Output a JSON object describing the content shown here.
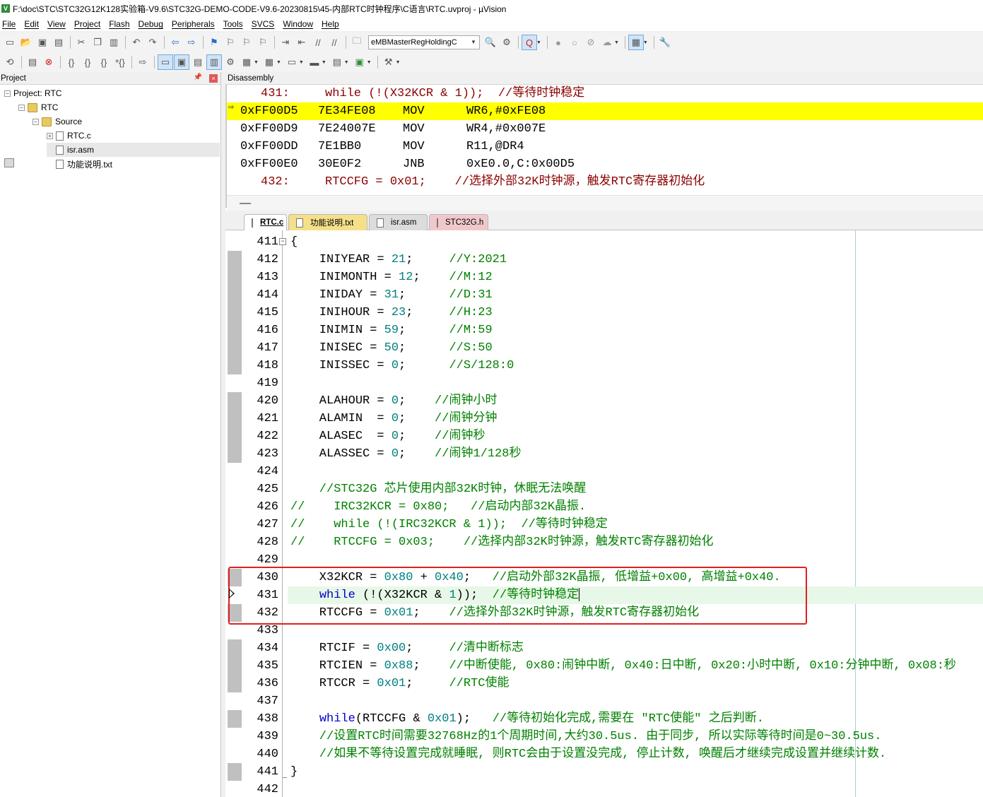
{
  "window": {
    "title": "F:\\doc\\STC\\STC32G12K128实验箱-V9.6\\STC32G-DEMO-CODE-V9.6-20230815\\45-内部RTC时钟程序\\C语言\\RTC.uvproj - µVision"
  },
  "menu": [
    "File",
    "Edit",
    "View",
    "Project",
    "Flash",
    "Debug",
    "Peripherals",
    "Tools",
    "SVCS",
    "Window",
    "Help"
  ],
  "toolbar": {
    "target_combo": "eMBMasterRegHoldingC"
  },
  "project_pane": {
    "title": "Project",
    "tree": [
      {
        "label": "Project: RTC",
        "type": "proj"
      },
      {
        "label": "RTC",
        "type": "folder"
      },
      {
        "label": "Source",
        "type": "folder"
      },
      {
        "label": "RTC.c",
        "type": "file"
      },
      {
        "label": "isr.asm",
        "type": "file"
      },
      {
        "label": "功能说明.txt",
        "type": "file"
      }
    ]
  },
  "disassembly": {
    "title": "Disassembly",
    "rows": [
      {
        "kind": "src",
        "num": "431:",
        "text": "while (!(X32KCR & 1));  //等待时钟稳定"
      },
      {
        "kind": "asm",
        "addr": "0xFF00D5",
        "opcode": "7E34FE08",
        "mnem": "MOV",
        "ops": "WR6,#0xFE08",
        "current": true
      },
      {
        "kind": "asm",
        "addr": "0xFF00D9",
        "opcode": "7E24007E",
        "mnem": "MOV",
        "ops": "WR4,#0x007E"
      },
      {
        "kind": "asm",
        "addr": "0xFF00DD",
        "opcode": "7E1BB0",
        "mnem": "MOV",
        "ops": "R11,@DR4"
      },
      {
        "kind": "asm",
        "addr": "0xFF00E0",
        "opcode": "30E0F2",
        "mnem": "JNB",
        "ops": "0xE0.0,C:0x00D5"
      },
      {
        "kind": "src",
        "num": "432:",
        "text": "RTCCFG = 0x01;    //选择外部32K时钟源，触发RTC寄存器初始化"
      }
    ]
  },
  "tabs": [
    {
      "label": "RTC.c",
      "active": true,
      "color": "#ffffff"
    },
    {
      "label": "功能说明.txt",
      "color": "#f5e08a"
    },
    {
      "label": "isr.asm",
      "color": "#dcdcdc"
    },
    {
      "label": "STC32G.h",
      "color": "#f0c8cc"
    }
  ],
  "editor": {
    "lines": [
      {
        "n": "411",
        "t": [
          [
            "{",
            ""
          ]
        ],
        "fold": "open"
      },
      {
        "n": "412",
        "t": [
          [
            "    INIYEAR = ",
            ""
          ],
          [
            "21",
            "num"
          ],
          [
            ";     ",
            ""
          ],
          [
            "//Y:2021",
            "cm"
          ]
        ],
        "mark": true
      },
      {
        "n": "413",
        "t": [
          [
            "    INIMONTH = ",
            ""
          ],
          [
            "12",
            "num"
          ],
          [
            ";    ",
            ""
          ],
          [
            "//M:12",
            "cm"
          ]
        ],
        "mark": true
      },
      {
        "n": "414",
        "t": [
          [
            "    INIDAY = ",
            ""
          ],
          [
            "31",
            "num"
          ],
          [
            ";      ",
            ""
          ],
          [
            "//D:31",
            "cm"
          ]
        ],
        "mark": true
      },
      {
        "n": "415",
        "t": [
          [
            "    INIHOUR = ",
            ""
          ],
          [
            "23",
            "num"
          ],
          [
            ";     ",
            ""
          ],
          [
            "//H:23",
            "cm"
          ]
        ],
        "mark": true
      },
      {
        "n": "416",
        "t": [
          [
            "    INIMIN = ",
            ""
          ],
          [
            "59",
            "num"
          ],
          [
            ";      ",
            ""
          ],
          [
            "//M:59",
            "cm"
          ]
        ],
        "mark": true
      },
      {
        "n": "417",
        "t": [
          [
            "    INISEC = ",
            ""
          ],
          [
            "50",
            "num"
          ],
          [
            ";      ",
            ""
          ],
          [
            "//S:50",
            "cm"
          ]
        ],
        "mark": true
      },
      {
        "n": "418",
        "t": [
          [
            "    INISSEC = ",
            ""
          ],
          [
            "0",
            "num"
          ],
          [
            ";      ",
            ""
          ],
          [
            "//S/128:0",
            "cm"
          ]
        ],
        "mark": true
      },
      {
        "n": "419",
        "t": []
      },
      {
        "n": "420",
        "t": [
          [
            "    ALAHOUR = ",
            ""
          ],
          [
            "0",
            "num"
          ],
          [
            ";    ",
            ""
          ],
          [
            "//闹钟小时",
            "cm"
          ]
        ],
        "mark": true
      },
      {
        "n": "421",
        "t": [
          [
            "    ALAMIN  = ",
            ""
          ],
          [
            "0",
            "num"
          ],
          [
            ";    ",
            ""
          ],
          [
            "//闹钟分钟",
            "cm"
          ]
        ],
        "mark": true
      },
      {
        "n": "422",
        "t": [
          [
            "    ALASEC  = ",
            ""
          ],
          [
            "0",
            "num"
          ],
          [
            ";    ",
            ""
          ],
          [
            "//闹钟秒",
            "cm"
          ]
        ],
        "mark": true
      },
      {
        "n": "423",
        "t": [
          [
            "    ALASSEC = ",
            ""
          ],
          [
            "0",
            "num"
          ],
          [
            ";    ",
            ""
          ],
          [
            "//闹钟1/128秒",
            "cm"
          ]
        ],
        "mark": true
      },
      {
        "n": "424",
        "t": []
      },
      {
        "n": "425",
        "t": [
          [
            "    //STC32G 芯片使用内部32K时钟，休眠无法唤醒",
            "cm"
          ]
        ]
      },
      {
        "n": "426",
        "t": [
          [
            "//    IRC32KCR = 0x80;   //启动内部32K晶振.",
            "cm"
          ]
        ]
      },
      {
        "n": "427",
        "t": [
          [
            "//    while (!(IRC32KCR & 1));  //等待时钟稳定",
            "cm"
          ]
        ]
      },
      {
        "n": "428",
        "t": [
          [
            "//    RTCCFG = 0x03;    //选择内部32K时钟源，触发RTC寄存器初始化",
            "cm"
          ]
        ]
      },
      {
        "n": "429",
        "t": []
      },
      {
        "n": "430",
        "t": [
          [
            "    X32KCR = ",
            ""
          ],
          [
            "0x80",
            "num"
          ],
          [
            " + ",
            ""
          ],
          [
            "0x40",
            "num"
          ],
          [
            ";   ",
            ""
          ],
          [
            "//启动外部32K晶振, 低增益+0x00, 高增益+0x40.",
            "cm"
          ]
        ],
        "mark": true
      },
      {
        "n": "431",
        "t": [
          [
            "    ",
            ""
          ],
          [
            "while",
            "kw"
          ],
          [
            " (!(X32KCR & ",
            ""
          ],
          [
            "1",
            "num"
          ],
          [
            "));  ",
            ""
          ],
          [
            "//等待时钟稳定",
            "cm"
          ]
        ],
        "current": true,
        "cursor": true
      },
      {
        "n": "432",
        "t": [
          [
            "    RTCCFG = ",
            ""
          ],
          [
            "0x01",
            "num"
          ],
          [
            ";    ",
            ""
          ],
          [
            "//选择外部32K时钟源，触发RTC寄存器初始化",
            "cm"
          ]
        ],
        "mark": true
      },
      {
        "n": "433",
        "t": []
      },
      {
        "n": "434",
        "t": [
          [
            "    RTCIF = ",
            ""
          ],
          [
            "0x00",
            "num"
          ],
          [
            ";     ",
            ""
          ],
          [
            "//清中断标志",
            "cm"
          ]
        ],
        "mark": true
      },
      {
        "n": "435",
        "t": [
          [
            "    RTCIEN = ",
            ""
          ],
          [
            "0x88",
            "num"
          ],
          [
            ";    ",
            ""
          ],
          [
            "//中断使能, 0x80:闹钟中断, 0x40:日中断, 0x20:小时中断, 0x10:分钟中断, 0x08:秒",
            "cm"
          ]
        ],
        "mark": true
      },
      {
        "n": "436",
        "t": [
          [
            "    RTCCR = ",
            ""
          ],
          [
            "0x01",
            "num"
          ],
          [
            ";     ",
            ""
          ],
          [
            "//RTC使能",
            "cm"
          ]
        ],
        "mark": true
      },
      {
        "n": "437",
        "t": []
      },
      {
        "n": "438",
        "t": [
          [
            "    ",
            ""
          ],
          [
            "while",
            "kw"
          ],
          [
            "(RTCCFG & ",
            ""
          ],
          [
            "0x01",
            "num"
          ],
          [
            ");   ",
            ""
          ],
          [
            "//等待初始化完成,需要在 \"RTC使能\" 之后判断.",
            "cm"
          ]
        ],
        "mark": true
      },
      {
        "n": "439",
        "t": [
          [
            "    //设置RTC时间需要32768Hz的1个周期时间,大约30.5us. 由于同步, 所以实际等待时间是0~30.5us.",
            "cm"
          ]
        ]
      },
      {
        "n": "440",
        "t": [
          [
            "    //如果不等待设置完成就睡眠, 则RTC会由于设置没完成, 停止计数, 唤醒后才继续完成设置并继续计数.",
            "cm"
          ]
        ]
      },
      {
        "n": "441",
        "t": [
          [
            "}",
            ""
          ]
        ],
        "mark": true,
        "fold": "end"
      },
      {
        "n": "442",
        "t": []
      }
    ]
  }
}
